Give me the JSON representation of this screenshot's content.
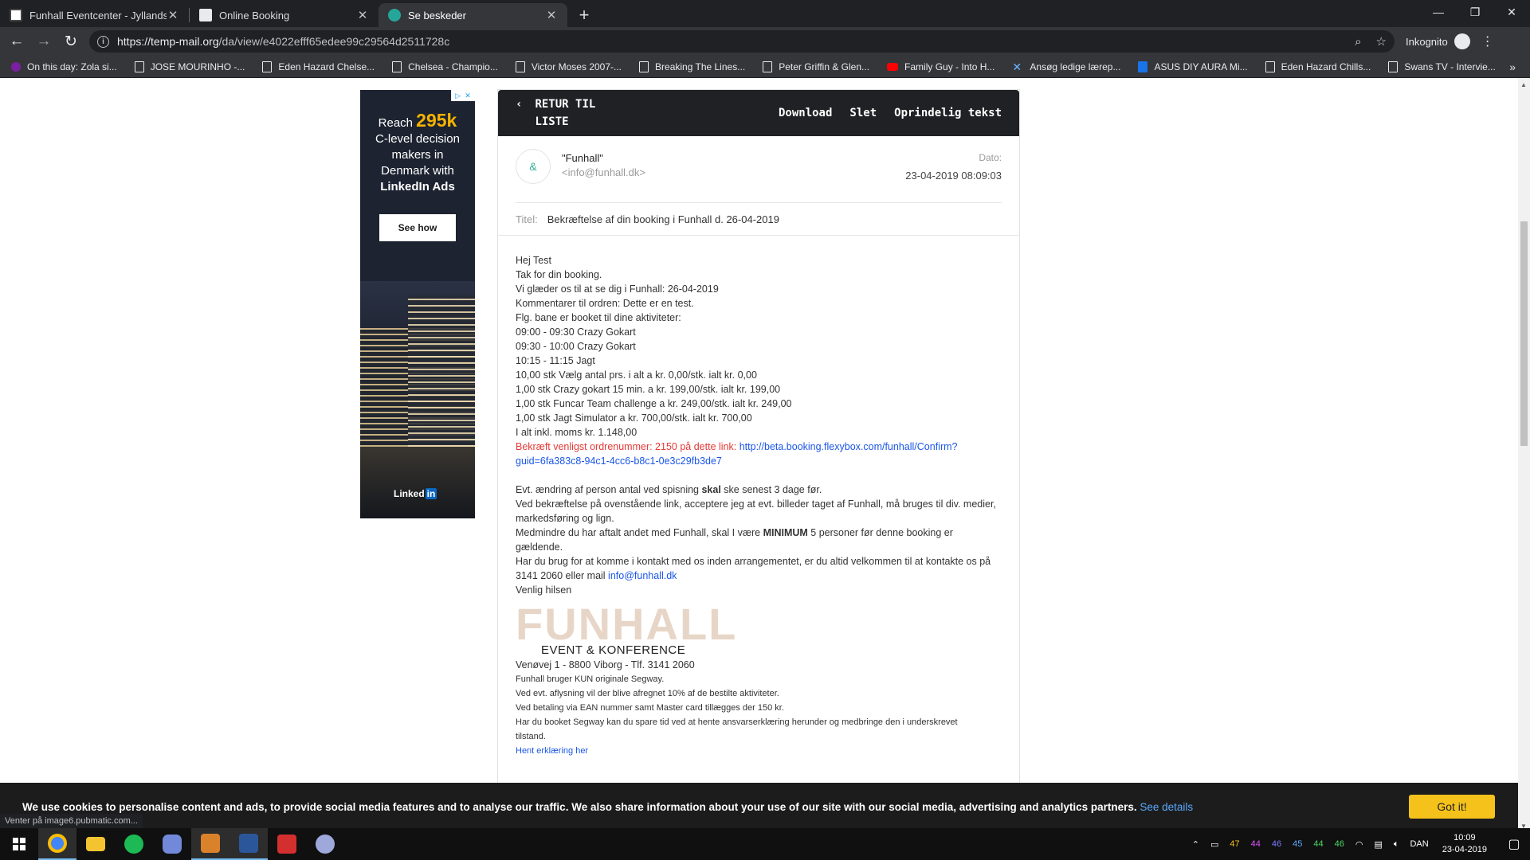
{
  "browser": {
    "tabs": [
      {
        "title": "Funhall Eventcenter - Jyllands st",
        "favicon_color": "#ffffff",
        "active": false
      },
      {
        "title": "Online Booking",
        "favicon_color": "#8ab4f8",
        "active": false
      },
      {
        "title": "Se beskeder",
        "favicon_color": "#26a69a",
        "active": true
      }
    ],
    "new_tab_glyph": "+",
    "url_host": "https://temp-mail.org",
    "url_path": "/da/view/e4022efff65edee99c29564d2511728c",
    "incognito_label": "Inkognito",
    "bookmarks": [
      {
        "label": "On this day: Zola si...",
        "icon": "other-icon"
      },
      {
        "label": "JOSE MOURINHO -...",
        "icon": "page-icon"
      },
      {
        "label": "Eden Hazard Chelse...",
        "icon": "page-icon"
      },
      {
        "label": "Chelsea - Champio...",
        "icon": "page-icon"
      },
      {
        "label": "Victor Moses 2007-...",
        "icon": "page-icon"
      },
      {
        "label": "Breaking The Lines...",
        "icon": "page-icon"
      },
      {
        "label": "Peter Griffin & Glen...",
        "icon": "page-icon"
      },
      {
        "label": "Family Guy - Into H...",
        "icon": "youtube-icon"
      },
      {
        "label": "Ansøg ledige lærep...",
        "icon": "x-icon"
      },
      {
        "label": "ASUS DIY AURA Mi...",
        "icon": "blue-icon"
      },
      {
        "label": "Eden Hazard Chills...",
        "icon": "page-icon"
      },
      {
        "label": "Swans TV - Intervie...",
        "icon": "page-icon"
      }
    ],
    "more_glyph": "»",
    "status_text": "Venter på image6.pubmatic.com..."
  },
  "ad": {
    "reach_prefix": "Reach",
    "reach_number": "295k",
    "line2": "C-level decision",
    "line3": "makers in",
    "line4": "Denmark with",
    "line5": "LinkedIn Ads",
    "cta": "See how",
    "logo_text": "Linked",
    "logo_in": "in"
  },
  "mail": {
    "back_label": "RETUR TIL LISTE",
    "actions": [
      "Download",
      "Slet",
      "Oprindelig tekst"
    ],
    "avatar_glyph": "&",
    "sender_name": "\"Funhall\"",
    "sender_email": "<info@funhall.dk>",
    "date_label": "Dato:",
    "date_value": "23-04-2019 08:09:03",
    "subject_label": "Titel:",
    "subject_value": "Bekræftelse af din booking i Funhall d. 26-04-2019",
    "body_lines": [
      "Hej Test",
      "Tak for din booking.",
      "Vi glæder os til at se dig i Funhall: 26-04-2019",
      "Kommentarer til ordren:  Dette er en test.",
      "Flg. bane er booket til dine aktiviteter:",
      "09:00 - 09:30 Crazy Gokart",
      "09:30 - 10:00 Crazy Gokart",
      "10:15 - 11:15 Jagt",
      "10,00 stk Vælg antal prs. i alt a kr. 0,00/stk. ialt kr. 0,00",
      "1,00 stk Crazy gokart 15 min. a kr. 199,00/stk. ialt kr. 199,00",
      "1,00 stk Funcar Team challenge a kr. 249,00/stk. ialt kr. 249,00",
      "1,00 stk Jagt Simulator a kr. 700,00/stk. ialt kr. 700,00",
      "I alt inkl. moms kr. 1.148,00"
    ],
    "confirm_text": "Bekræft venligst ordrenummer:  2150 på dette link:",
    "confirm_link_1": "http://beta.booking.flexybox.com/funhall/Confirm?",
    "confirm_link_2": "guid=6fa383c8-94c1-4cc6-b8c1-0e3c29fb3de7",
    "para1_a": "Evt. ændring af person antal ved spisning ",
    "para1_b": "skal",
    "para1_c": " ske senest 3 dage før.",
    "para2_a": "Ved bekræftelse på ovenstående link, acceptere jeg at evt. billeder taget af Funhall, må bruges til div. medier,",
    "para2_b": "markedsføring og lign.",
    "para3_a": "Medmindre du har aftalt andet med Funhall, skal I være ",
    "para3_b": "MINIMUM",
    "para3_c": " 5 personer før denne booking er",
    "para3_d": "gældende.",
    "para4_a": "Har du brug for at komme i kontakt med os inden arrangementet, er du altid velkommen til at kontakte os på",
    "para4_b": "3141 2060 eller mail ",
    "para4_link": "info@funhall.dk",
    "regards": "Venlig hilsen",
    "logo_word": "FUNHALL",
    "logo_sub": "EVENT & KONFERENCE",
    "address": "Venøvej 1 - 8800 Viborg - Tlf. 3141 2060",
    "small_lines": [
      "Funhall bruger KUN originale Segway.",
      "Ved evt. aflysning vil der blive afregnet 10% af de bestilte aktiviteter.",
      "Ved betaling via EAN nummer samt Master card tillægges der 150 kr.",
      "Har du booket Segway kan du spare tid ved at hente ansvarserklæring herunder og medbringe den i underskrevet",
      "tilstand."
    ],
    "download_link": "Hent erklæring her"
  },
  "cookie": {
    "text": "We use cookies to personalise content and ads, to provide social media features and to analyse our traffic. We also share information about your use of our site with our social media, advertising and analytics partners.",
    "link": "See details",
    "button": "Got it!"
  },
  "taskbar": {
    "apps": [
      {
        "name": "chrome-icon",
        "color": "#4285f4",
        "active": true
      },
      {
        "name": "file-explorer-icon",
        "color": "#f4c430",
        "active": false
      },
      {
        "name": "spotify-icon",
        "color": "#1db954",
        "active": false
      },
      {
        "name": "discord-icon",
        "color": "#7289da",
        "active": false
      },
      {
        "name": "paint-icon",
        "color": "#d9822b",
        "active": true
      },
      {
        "name": "word-icon",
        "color": "#2b579a",
        "active": true
      },
      {
        "name": "acrobat-icon",
        "color": "#d32f2f",
        "active": false
      },
      {
        "name": "paint-palette-icon",
        "color": "#9fa8da",
        "active": false
      }
    ],
    "tray_numbers": [
      "47",
      "44",
      "46",
      "45",
      "44",
      "46"
    ],
    "tray_colors": [
      "#f5c21b",
      "#e056fd",
      "#7b7bff",
      "#5aa9ff",
      "#4cd964",
      "#4cd964"
    ],
    "language": "DAN",
    "time": "10:09",
    "date": "23-04-2019"
  }
}
